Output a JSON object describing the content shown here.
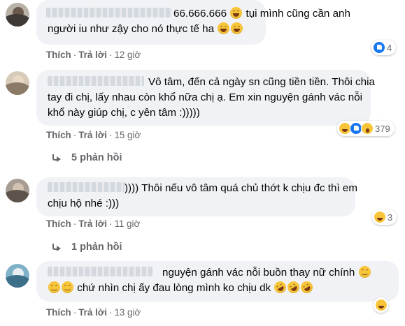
{
  "comments": [
    {
      "number_prefix": "66.666.666",
      "line1": "tụi mình cũng cần anh",
      "line2": "người iu như zậy cho nó thực tế ha",
      "actions": {
        "like": "Thích",
        "reply": "Trả lời",
        "time": "12 giờ"
      },
      "reaction_count": "4"
    },
    {
      "line1": "Vô tâm, đến cả ngày sn cũng tiền tiền. Thôi chia",
      "line2": "tay đi chị, lấy nhau còn khổ nữa chị ạ. Em xin nguyện gánh vác nỗi",
      "line3": "khổ này giúp chị, c yên tâm :)))))",
      "actions": {
        "like": "Thích",
        "reply": "Trả lời",
        "time": "15 giờ"
      },
      "reaction_count": "379",
      "replies_label": "5 phản hồi"
    },
    {
      "line1": ")))) Thôi nếu vô tâm quá chủ thớt k chịu đc thì em",
      "line2": "chịu hộ nhé :)))",
      "actions": {
        "like": "Thích",
        "reply": "Trả lời",
        "time": "11 giờ"
      },
      "reaction_count": "3",
      "replies_label": "1 phản hồi"
    },
    {
      "line1": "nguyện gánh vác nỗi buồn thay nữ chính",
      "line2": "chứ nhìn chị ấy đau lòng mình ko chịu dk",
      "actions": {
        "like": "Thích",
        "reply": "Trả lời",
        "time": "13 giờ"
      }
    }
  ],
  "colors": {
    "bubble": "#f0f2f5",
    "meta_text": "#65676b",
    "like_blue": "#1877f2",
    "emoji_yellow": "#f8c53a"
  }
}
